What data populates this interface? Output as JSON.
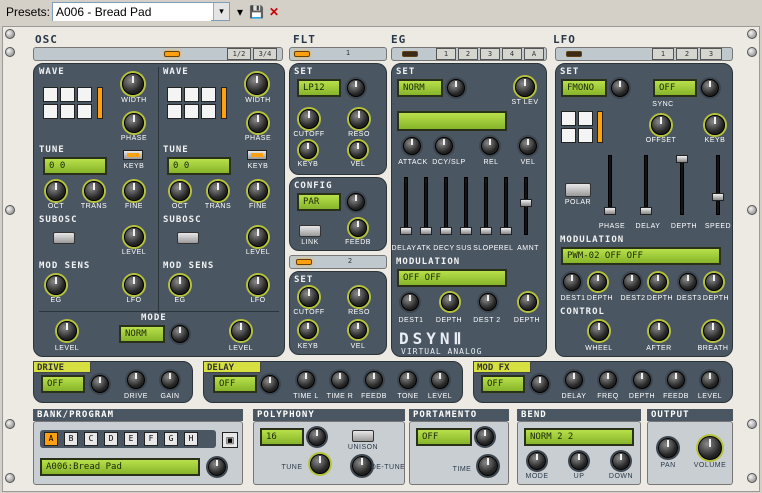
{
  "toolbar": {
    "presets_label": "Presets:",
    "preset_value": "A006 - Bread Pad",
    "dropdown_arrow": "▾",
    "menu_arrow": "▾",
    "save_icon": "💾",
    "close_icon": "✕"
  },
  "sections": {
    "osc": "OSC",
    "flt": "FLT",
    "eg": "EG",
    "lfo": "LFO"
  },
  "osc": {
    "tabs": [
      "1/2",
      "3/4"
    ],
    "osc1": {
      "wave": "WAVE",
      "width": "WIDTH",
      "phase": "PHASE",
      "tune": "TUNE",
      "tune_lcd": "0       0",
      "keyb": "KEYB",
      "oct": "OCT",
      "trans": "TRANS",
      "fine": "FINE",
      "subosc": "SUBOSC",
      "level": "LEVEL",
      "modsens": "MOD SENS",
      "eg": "EG",
      "lfo": "LFO"
    },
    "osc2": {
      "wave": "WAVE",
      "width": "WIDTH",
      "phase": "PHASE",
      "tune": "TUNE",
      "tune_lcd": "0       0",
      "keyb": "KEYB",
      "oct": "OCT",
      "trans": "TRANS",
      "fine": "FINE",
      "subosc": "SUBOSC",
      "level": "LEVEL",
      "modsens": "MOD SENS",
      "eg": "EG",
      "lfo": "LFO"
    },
    "mode": "MODE",
    "mode_lcd": "NORM",
    "level_l": "LEVEL",
    "level_r": "LEVEL"
  },
  "flt": {
    "tab1": "1",
    "tab2": "2",
    "set": "SET",
    "type_lcd": "LP12",
    "cutoff": "CUTOFF",
    "reso": "RESO",
    "keyb": "KEYB",
    "vel": "VEL",
    "config": "CONFIG",
    "config_lcd": "PAR",
    "link": "LINK",
    "feedb": "FEEDB",
    "set2": "SET",
    "cutoff2": "CUTOFF",
    "reso2": "RESO",
    "keyb2": "KEYB",
    "vel2": "VEL"
  },
  "eg": {
    "tabs": [
      "1",
      "2",
      "3",
      "4",
      "A"
    ],
    "set": "SET",
    "mode_lcd": "NORM",
    "st_lev": "ST LEV",
    "attack": "ATTACK",
    "dcy_slp": "DCY/SLP",
    "rel": "REL",
    "vel": "VEL",
    "faders": [
      "DELAY",
      "ATK",
      "DECY",
      "SUS",
      "SLOPE",
      "REL",
      "AMNT"
    ],
    "modulation": "MODULATION",
    "mod_lcd": "OFF       OFF",
    "dest1": "DEST1",
    "depth1": "DEPTH",
    "dest2": "DEST 2",
    "depth2": "DEPTH",
    "logo": "DSYNⅡ",
    "logo_sub": "VIRTUAL ANALOG"
  },
  "lfo": {
    "tabs": [
      "1",
      "2",
      "3"
    ],
    "set": "SET",
    "mode_lcd": "FMONO",
    "sync": "SYNC",
    "sync_lcd": "OFF",
    "offset": "OFFSET",
    "keyb": "KEYB",
    "polar": "POLAR",
    "phase": "PHASE",
    "delay": "DELAY",
    "depth": "DEPTH",
    "speed": "SPEED",
    "modulation": "MODULATION",
    "mod_lcd": "PWM-02     OFF        OFF",
    "dest1": "DEST1",
    "dest2": "DEST2",
    "dest3": "DEST3",
    "control": "CONTROL",
    "wheel": "WHEEL",
    "after": "AFTER",
    "breath": "BREATH"
  },
  "fx": {
    "drive": {
      "title": "DRIVE",
      "lcd": "OFF",
      "drive": "DRIVE",
      "gain": "GAIN"
    },
    "delay": {
      "title": "DELAY",
      "lcd": "OFF",
      "time_l": "TIME L",
      "time_r": "TIME R",
      "feedb": "FEEDB",
      "tone": "TONE",
      "level": "LEVEL"
    },
    "modfx": {
      "title": "MOD FX",
      "lcd": "OFF",
      "delay": "DELAY",
      "freq": "FREQ",
      "depth": "DEPTH",
      "feedb": "FEEDB",
      "level": "LEVEL"
    }
  },
  "bank": {
    "title": "BANK/PROGRAM",
    "letters": [
      "A",
      "B",
      "C",
      "D",
      "E",
      "F",
      "G",
      "H"
    ],
    "program_lcd": "A006:Bread Pad"
  },
  "poly": {
    "title": "POLYPHONY",
    "lcd": "16",
    "unison": "UNISON",
    "tune": "TUNE",
    "detune": "DE-TUNE"
  },
  "porta": {
    "title": "PORTAMENTO",
    "lcd": "OFF",
    "time": "TIME"
  },
  "bend": {
    "title": "BEND",
    "lcd": "NORM      2        2",
    "mode": "MODE",
    "up": "UP",
    "down": "DOWN"
  },
  "output": {
    "title": "OUTPUT",
    "pan": "PAN",
    "volume": "VOLUME"
  }
}
